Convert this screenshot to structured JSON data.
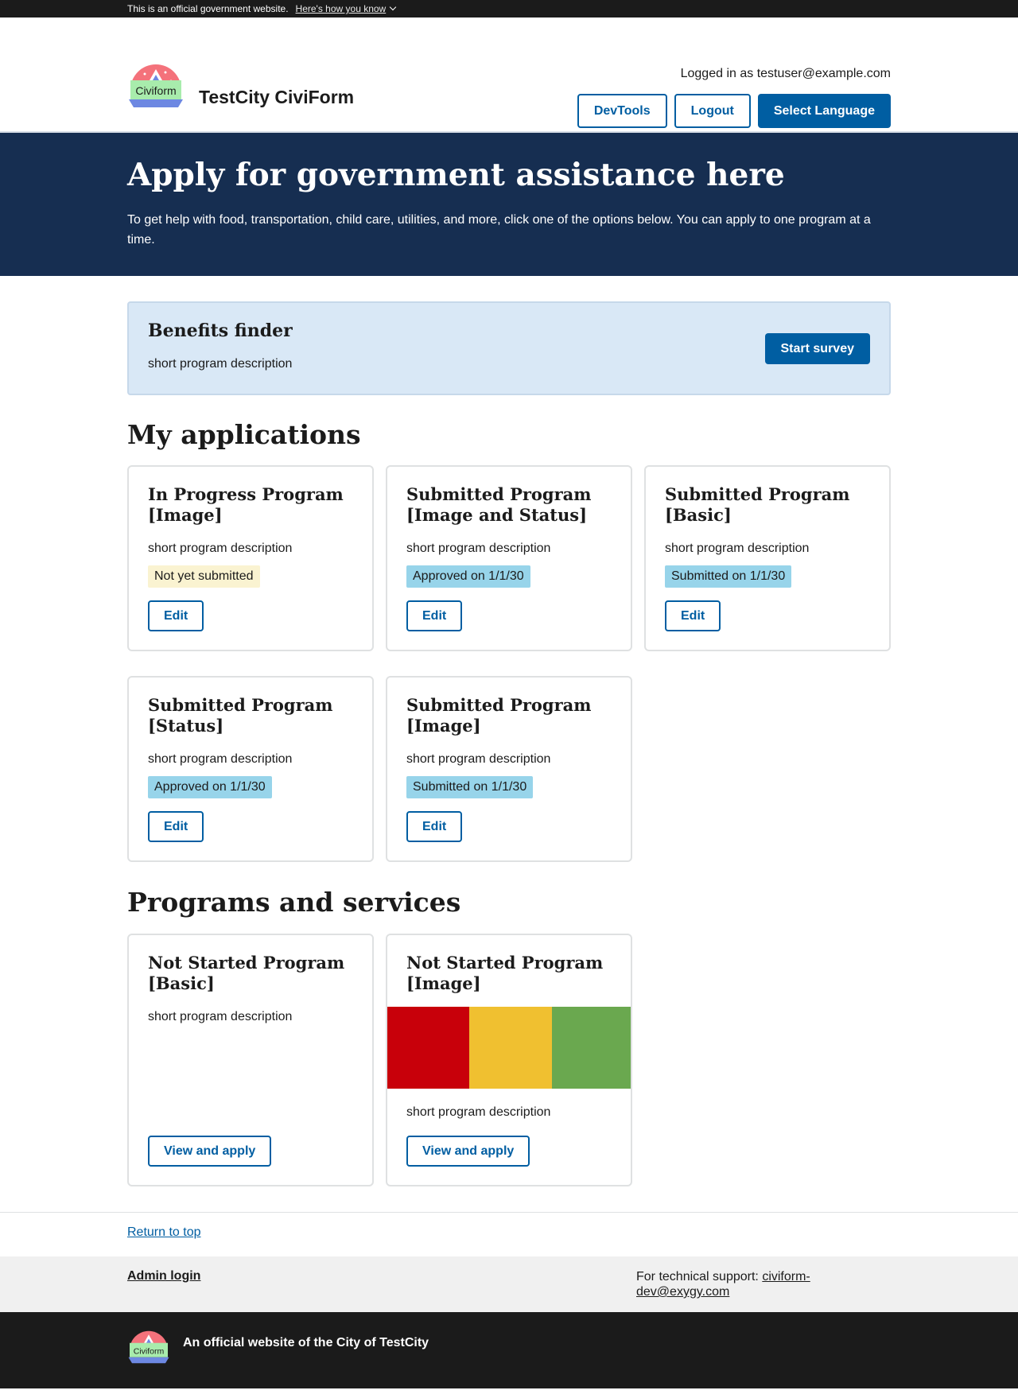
{
  "gov_banner": {
    "text": "This is an official government website.",
    "link": "Here's how you know"
  },
  "header": {
    "logo_text": "Civiform",
    "site_name": "TestCity CiviForm",
    "logged_in": "Logged in as testuser@example.com",
    "buttons": {
      "devtools": "DevTools",
      "logout": "Logout",
      "language": "Select Language"
    }
  },
  "hero": {
    "title": "Apply for government assistance here",
    "subtitle": "To get help with food, transportation, child care, utilities, and more, click one of the options below. You can apply to one program at a time."
  },
  "finder": {
    "title": "Benefits finder",
    "description": "short program description",
    "button": "Start survey"
  },
  "my_applications": {
    "heading": "My applications",
    "cards": [
      {
        "title": "In Progress Program [Image]",
        "description": "short program description",
        "status": "Not yet submitted",
        "status_color": "#faf3d1",
        "button": "Edit"
      },
      {
        "title": "Submitted Program [Image and Status]",
        "description": "short program description",
        "status": "Approved on 1/1/30",
        "status_color": "#97d4ea",
        "button": "Edit"
      },
      {
        "title": "Submitted Program [Basic]",
        "description": "short program description",
        "status": "Submitted on 1/1/30",
        "status_color": "#97d4ea",
        "button": "Edit"
      },
      {
        "title": "Submitted Program [Status]",
        "description": "short program description",
        "status": "Approved on 1/1/30",
        "status_color": "#97d4ea",
        "button": "Edit"
      },
      {
        "title": "Submitted Program [Image]",
        "description": "short program description",
        "status": "Submitted on 1/1/30",
        "status_color": "#97d4ea",
        "button": "Edit"
      }
    ]
  },
  "programs": {
    "heading": "Programs and services",
    "cards": [
      {
        "title": "Not Started Program [Basic]",
        "description": "short program description",
        "button": "View and apply"
      },
      {
        "title": "Not Started Program [Image]",
        "description": "short program description",
        "button": "View and apply",
        "image_colors": [
          "#c8000a",
          "#f0c030",
          "#6aa84f"
        ]
      }
    ]
  },
  "footer": {
    "return_top": "Return to top",
    "admin_login": "Admin login",
    "support_label": "For technical support:",
    "support_email": "civiform-dev@exygy.com",
    "official": "An official website of the City of TestCity",
    "logo_text": "Civiform"
  },
  "colors": {
    "primary": "#005ea2",
    "hero_bg": "#162e51",
    "finder_bg": "#d9e8f6",
    "footer_dark": "#1b1b1b"
  }
}
